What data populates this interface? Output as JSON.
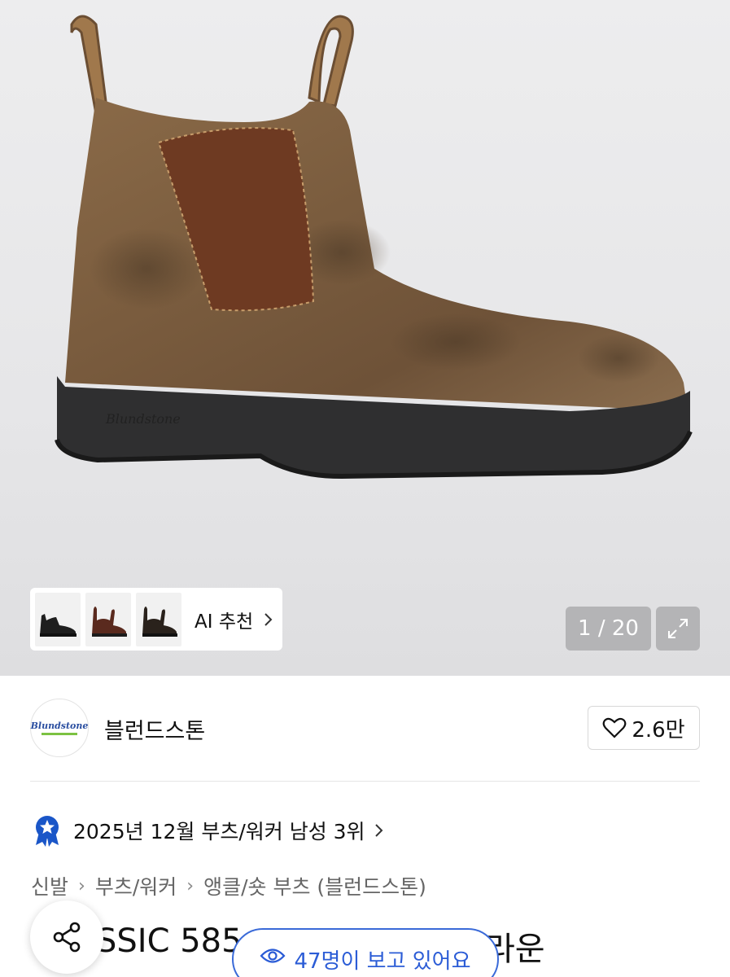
{
  "gallery": {
    "ai_recommend_label": "AI 추천",
    "counter": "1 / 20",
    "icons": [
      "chevron-right-icon",
      "expand-icon"
    ]
  },
  "brand": {
    "name": "블런드스톤",
    "logo_text": "Blundstone",
    "likes": "2.6만",
    "heart_icon": "heart-icon"
  },
  "ranking": {
    "text": "2025년 12월 부츠/워커 남성 3위",
    "badge_icon": "star-badge-icon"
  },
  "breadcrumb": [
    "신발",
    "부츠/워커",
    "앵클/숏 부츠 (블런드스톤)"
  ],
  "product": {
    "title_visible": "SSIC 585",
    "title_tail": "라운"
  },
  "viewers": {
    "text": "47명이 보고 있어요",
    "icon": "eye-icon"
  },
  "colors": {
    "accent_blue": "#2b5cd6",
    "badge_blue": "#1a56c8"
  }
}
